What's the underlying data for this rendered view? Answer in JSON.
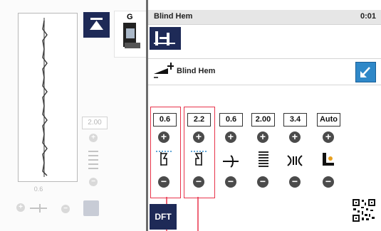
{
  "left_panel": {
    "width_value": "2.00",
    "length_value": "0.6",
    "foot_label": "G"
  },
  "header": {
    "title": "Blind Hem",
    "time": "0:01"
  },
  "stitch_name": "Blind Hem",
  "settings": [
    {
      "value": "0.6",
      "symbol": "blind-hem-left-icon"
    },
    {
      "value": "2.2",
      "symbol": "blind-hem-right-icon"
    },
    {
      "value": "0.6",
      "symbol": "needle-position-icon"
    },
    {
      "value": "2.00",
      "symbol": "stitch-length-icon"
    },
    {
      "value": "3.4",
      "symbol": "tension-icon"
    },
    {
      "value": "Auto",
      "symbol": "presser-foot-pressure-icon"
    }
  ],
  "footer": {
    "dft_label": "DFT"
  },
  "colors": {
    "navy": "#1e2a57",
    "highlight_red": "#e8334a",
    "blue_button": "#2f88c8"
  }
}
